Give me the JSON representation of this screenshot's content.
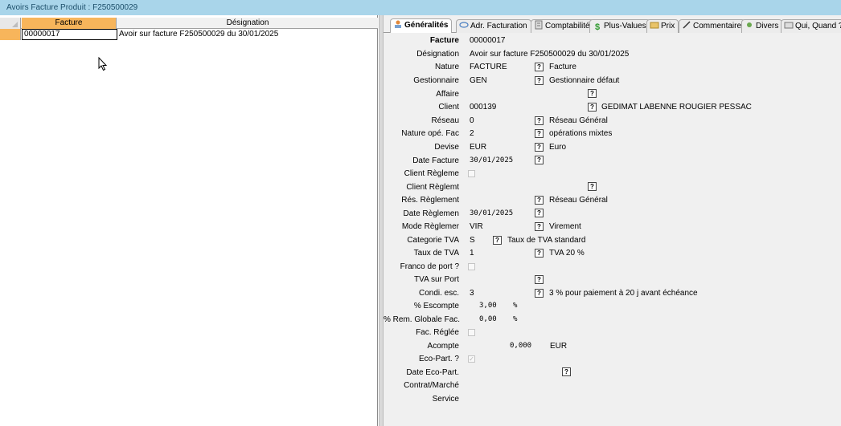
{
  "window": {
    "title": "Avoirs Facture Produit : F250500029"
  },
  "grid": {
    "columns": [
      "Facture",
      "Désignation"
    ],
    "rows": [
      {
        "facture": "00000017",
        "designation": "Avoir sur facture F250500029 du 30/01/2025"
      }
    ]
  },
  "tabs": [
    {
      "label": "Généralités",
      "icon": "general-icon"
    },
    {
      "label": "Adr. Facturation",
      "icon": "address-icon"
    },
    {
      "label": "Comptabilité",
      "icon": "accounting-icon"
    },
    {
      "label": "Plus-Values",
      "icon": "dollar-icon"
    },
    {
      "label": "Prix",
      "icon": "price-icon"
    },
    {
      "label": "Commentaire",
      "icon": "pen-icon"
    },
    {
      "label": "Divers",
      "icon": "misc-icon"
    },
    {
      "label": "Qui, Quand ?",
      "icon": "who-icon"
    }
  ],
  "form": {
    "facture": {
      "label": "Facture",
      "value": "00000017"
    },
    "designation": {
      "label": "Désignation",
      "value": "Avoir sur facture F250500029 du 30/01/2025"
    },
    "nature": {
      "label": "Nature",
      "value": "FACTURE",
      "desc": "Facture"
    },
    "gestionnaire": {
      "label": "Gestionnaire",
      "value": "GEN",
      "desc": "Gestionnaire défaut"
    },
    "affaire": {
      "label": "Affaire"
    },
    "client": {
      "label": "Client",
      "value": "000139",
      "desc": "GEDIMAT LABENNE ROUGIER PESSAC"
    },
    "reseau": {
      "label": "Réseau",
      "value": "0",
      "desc": "Réseau Général"
    },
    "nature_ope": {
      "label": "Nature opé. Fac",
      "value": "2",
      "desc": "opérations mixtes"
    },
    "devise": {
      "label": "Devise",
      "value": "EUR",
      "desc": "Euro"
    },
    "date_facture": {
      "label": "Date Facture",
      "value": "30/01/2025"
    },
    "client_reglement_chk": {
      "label": "Client Règleme"
    },
    "client_reglement": {
      "label": "Client Règlemt"
    },
    "res_reglement": {
      "label": "Rés. Règlement",
      "desc": "Réseau Général"
    },
    "date_reglement": {
      "label": "Date Règlemen",
      "value": "30/01/2025"
    },
    "mode_reglement": {
      "label": "Mode Règlemer",
      "value": "VIR",
      "desc": "Virement"
    },
    "categorie_tva": {
      "label": "Categorie TVA",
      "value": "S",
      "desc": "Taux de TVA standard"
    },
    "taux_tva": {
      "label": "Taux de TVA",
      "value": "1",
      "desc": "TVA 20 %"
    },
    "franco_port": {
      "label": "Franco de port ?"
    },
    "tva_port": {
      "label": "TVA sur Port"
    },
    "condi_esc": {
      "label": "Condi. esc.",
      "value": "3",
      "desc": "3 % pour paiement à 20 j avant échéance"
    },
    "pct_escompte": {
      "label": "% Escompte",
      "value": "3,00",
      "unit": "%"
    },
    "pct_rem_globale": {
      "label": "% Rem. Globale Fac.",
      "value": "0,00",
      "unit": "%"
    },
    "fac_reglee": {
      "label": "Fac. Réglée"
    },
    "acompte": {
      "label": "Acompte",
      "value": "0,000",
      "unit": "EUR"
    },
    "eco_part": {
      "label": "Eco-Part. ?"
    },
    "date_eco_part": {
      "label": "Date Eco-Part."
    },
    "contrat_marche": {
      "label": "Contrat/Marché"
    },
    "service": {
      "label": "Service"
    }
  },
  "lookup_glyph": "?"
}
